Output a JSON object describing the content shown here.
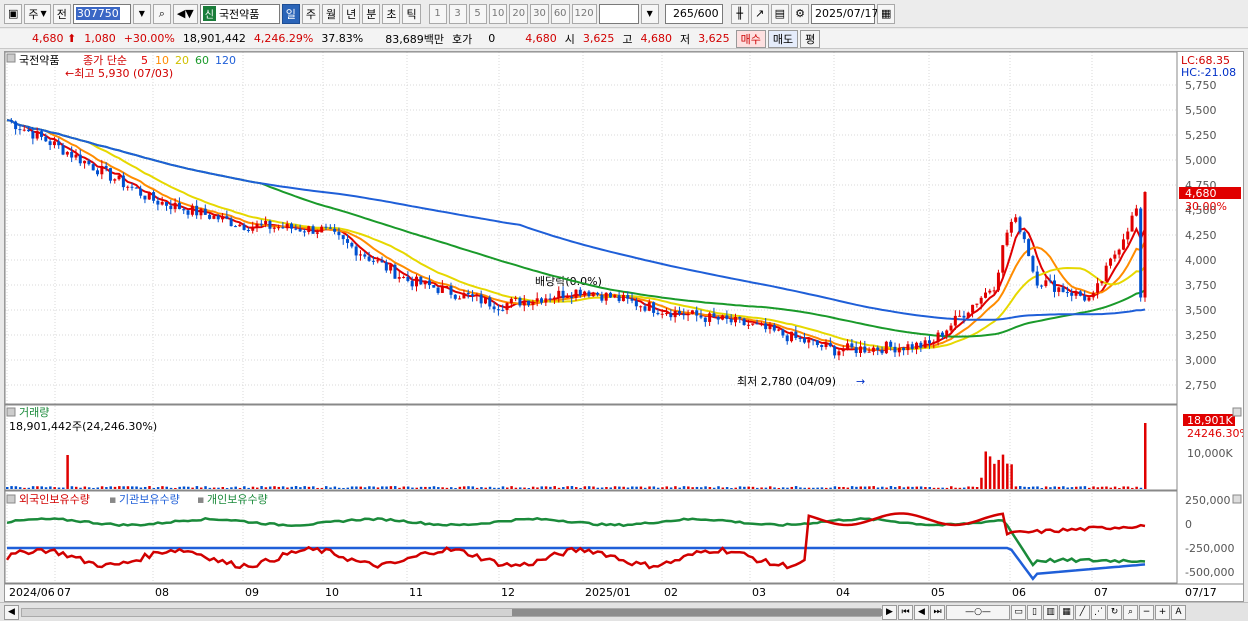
{
  "toolbar": {
    "period_select": "주",
    "prev_label": "전",
    "stock_code": "307750",
    "new_badge": "신",
    "stock_name": "국전약품",
    "periods": [
      "일",
      "주",
      "월",
      "년",
      "분",
      "초",
      "틱"
    ],
    "active_period": "일",
    "intervals": [
      "1",
      "3",
      "5",
      "10",
      "20",
      "30",
      "60",
      "120"
    ],
    "count": "265",
    "count_total": "/600",
    "date": "2025/07/17"
  },
  "quote": {
    "price": "4,680",
    "change": "1,080",
    "change_pct": "+30.00%",
    "volume": "18,901,442",
    "volume_pct": "4,246.29%",
    "turnover": "37.83%",
    "amount": "83,689백만",
    "hoga_label": "호가",
    "hoga_value": "0",
    "current": "4,680",
    "open_label": "시",
    "open": "3,625",
    "high_label": "고",
    "high": "4,680",
    "low_label": "저",
    "low": "3,625",
    "buy_label": "매수",
    "sell_label": "매도",
    "eval_label": "평"
  },
  "price_panel": {
    "title": "국전약품",
    "legend_prefix": "종가 단순",
    "ma_periods": [
      {
        "label": "5",
        "color": "#e00000"
      },
      {
        "label": "10",
        "color": "#ff8c00"
      },
      {
        "label": "20",
        "color": "#e6d800"
      },
      {
        "label": "60",
        "color": "#1a9a2a"
      },
      {
        "label": "120",
        "color": "#1f5fd8"
      }
    ],
    "max_annotation": "최고 5,930 (07/03)",
    "min_annotation": "최저 2,780 (04/09)",
    "dividend_annotation": "배당락(0.0%)",
    "lc": "LC:68.35",
    "hc": "HC:-21.08",
    "last_price_tag": "4,680",
    "last_pct_tag": "30.00%",
    "y_ticks": [
      "5,750",
      "5,500",
      "5,250",
      "5,000",
      "4,750",
      "4,500",
      "4,250",
      "4,000",
      "3,750",
      "3,500",
      "3,250",
      "3,000",
      "2,750"
    ]
  },
  "volume_panel": {
    "title": "거래량",
    "value_text": "18,901,442주(24,246.30%)",
    "last_tag": "18,901K",
    "last_pct_tag": "24246.30%",
    "y_tick": "10,000K"
  },
  "holdings_panel": {
    "legend": [
      {
        "label": "외국인보유수량",
        "color": "#d10000"
      },
      {
        "label": "기관보유수량",
        "color": "#1f5fd8"
      },
      {
        "label": "개인보유수량",
        "color": "#1a8a3a"
      }
    ],
    "y_ticks": [
      "250,000",
      "0",
      "-250,000",
      "-500,000"
    ]
  },
  "x_axis": {
    "labels": [
      "2024/06",
      "07",
      "08",
      "09",
      "10",
      "11",
      "12",
      "2025/01",
      "02",
      "03",
      "04",
      "05",
      "06",
      "07"
    ],
    "right_label": "07/17"
  },
  "colors": {
    "up": "#e00000",
    "down": "#0050d0",
    "grid": "#d9d9d9"
  },
  "chart_data": {
    "type": "candlestick",
    "candles_approx": [
      {
        "date": "2024/06",
        "close": 5400
      },
      {
        "date": "07",
        "close": 5150
      },
      {
        "date": "08",
        "close": 4600
      },
      {
        "date": "09",
        "close": 4350
      },
      {
        "date": "10",
        "close": 4300
      },
      {
        "date": "11",
        "close": 3800
      },
      {
        "date": "12",
        "close": 3550
      },
      {
        "date": "2025/01",
        "close": 3700
      },
      {
        "date": "02",
        "close": 3500
      },
      {
        "date": "03",
        "close": 3350
      },
      {
        "date": "04",
        "close": 3100
      },
      {
        "date": "05",
        "close": 3150
      },
      {
        "date": "06",
        "close": 3900
      },
      {
        "date": "07",
        "close": 3600
      },
      {
        "date": "07/17",
        "close": 4680
      }
    ],
    "y_range": [
      2750,
      5750
    ]
  }
}
